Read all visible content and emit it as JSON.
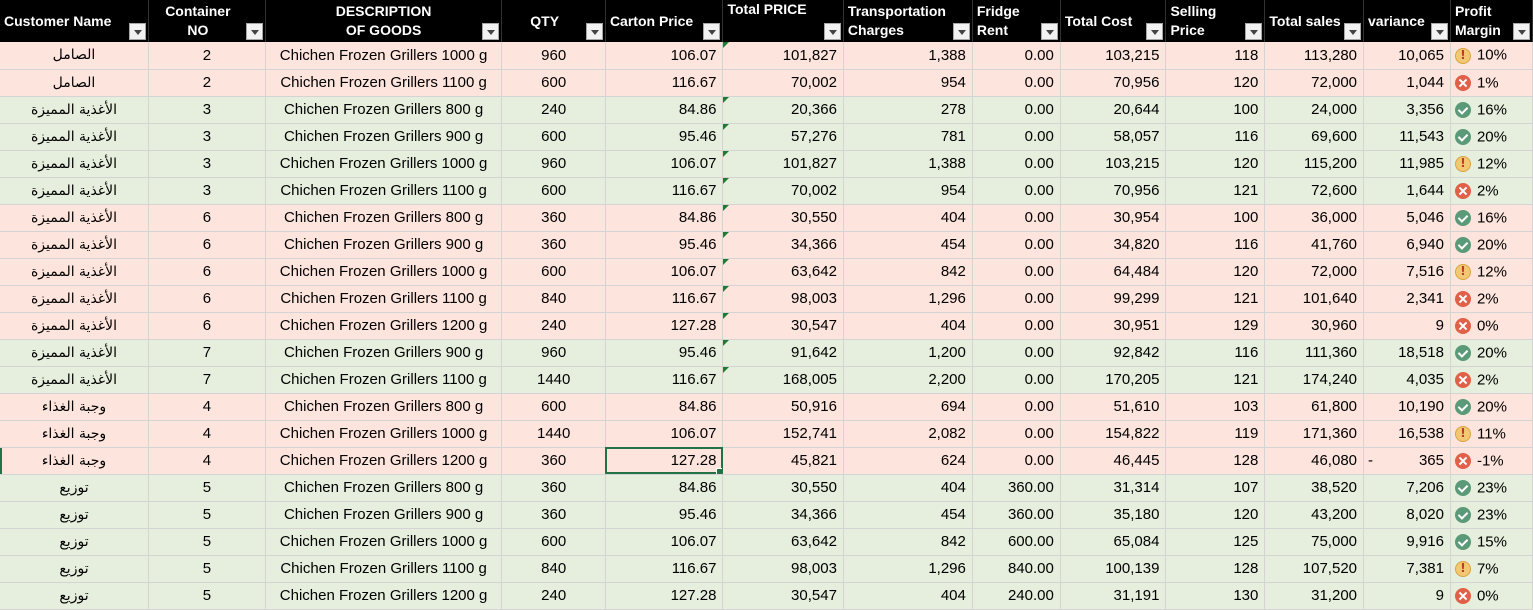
{
  "headers": [
    {
      "key": "customer",
      "label": "Customer Name"
    },
    {
      "key": "container",
      "label": "Container NO"
    },
    {
      "key": "description",
      "label": "DESCRIPTION OF GOODS"
    },
    {
      "key": "qty",
      "label": "QTY"
    },
    {
      "key": "carton_price",
      "label": "Carton Price"
    },
    {
      "key": "total_price",
      "label": "Total PRICE"
    },
    {
      "key": "transport",
      "label": "Transportation Charges"
    },
    {
      "key": "fridge",
      "label": "Fridge Rent"
    },
    {
      "key": "total_cost",
      "label": "Total Cost"
    },
    {
      "key": "selling",
      "label": "Selling Price"
    },
    {
      "key": "total_sales",
      "label": "Total sales"
    },
    {
      "key": "variance",
      "label": "variance"
    },
    {
      "key": "margin",
      "label": "Profit Margin"
    }
  ],
  "rows": [
    {
      "customer": "الصامل",
      "container": "2",
      "description": "Chichen Frozen Grillers 1000 g",
      "qty": "960",
      "carton_price": "106.07",
      "total_price": "101,827",
      "transport": "1,388",
      "fridge": "0.00",
      "total_cost": "103,215",
      "selling": "118",
      "total_sales": "113,280",
      "variance": "10,065",
      "variance_sign": "",
      "margin": "10%",
      "margin_icon": "warn",
      "fill": "pink"
    },
    {
      "customer": "الصامل",
      "container": "2",
      "description": "Chichen Frozen Grillers 1100 g",
      "qty": "600",
      "carton_price": "116.67",
      "total_price": "70,002",
      "transport": "954",
      "fridge": "0.00",
      "total_cost": "70,956",
      "selling": "120",
      "total_sales": "72,000",
      "variance": "1,044",
      "variance_sign": "",
      "margin": "1%",
      "margin_icon": "bad",
      "fill": "pink"
    },
    {
      "customer": "الأغذية المميزة",
      "container": "3",
      "description": "Chichen Frozen Grillers 800 g",
      "qty": "240",
      "carton_price": "84.86",
      "total_price": "20,366",
      "transport": "278",
      "fridge": "0.00",
      "total_cost": "20,644",
      "selling": "100",
      "total_sales": "24,000",
      "variance": "3,356",
      "variance_sign": "",
      "margin": "16%",
      "margin_icon": "ok",
      "fill": "green"
    },
    {
      "customer": "الأغذية المميزة",
      "container": "3",
      "description": "Chichen Frozen Grillers 900 g",
      "qty": "600",
      "carton_price": "95.46",
      "total_price": "57,276",
      "transport": "781",
      "fridge": "0.00",
      "total_cost": "58,057",
      "selling": "116",
      "total_sales": "69,600",
      "variance": "11,543",
      "variance_sign": "",
      "margin": "20%",
      "margin_icon": "ok",
      "fill": "green"
    },
    {
      "customer": "الأغذية المميزة",
      "container": "3",
      "description": "Chichen Frozen Grillers 1000 g",
      "qty": "960",
      "carton_price": "106.07",
      "total_price": "101,827",
      "transport": "1,388",
      "fridge": "0.00",
      "total_cost": "103,215",
      "selling": "120",
      "total_sales": "115,200",
      "variance": "11,985",
      "variance_sign": "",
      "margin": "12%",
      "margin_icon": "warn",
      "fill": "green"
    },
    {
      "customer": "الأغذية المميزة",
      "container": "3",
      "description": "Chichen Frozen Grillers 1100 g",
      "qty": "600",
      "carton_price": "116.67",
      "total_price": "70,002",
      "transport": "954",
      "fridge": "0.00",
      "total_cost": "70,956",
      "selling": "121",
      "total_sales": "72,600",
      "variance": "1,644",
      "variance_sign": "",
      "margin": "2%",
      "margin_icon": "bad",
      "fill": "green"
    },
    {
      "customer": "الأغذية المميزة",
      "container": "6",
      "description": "Chichen Frozen Grillers 800 g",
      "qty": "360",
      "carton_price": "84.86",
      "total_price": "30,550",
      "transport": "404",
      "fridge": "0.00",
      "total_cost": "30,954",
      "selling": "100",
      "total_sales": "36,000",
      "variance": "5,046",
      "variance_sign": "",
      "margin": "16%",
      "margin_icon": "ok",
      "fill": "pink"
    },
    {
      "customer": "الأغذية المميزة",
      "container": "6",
      "description": "Chichen Frozen Grillers 900 g",
      "qty": "360",
      "carton_price": "95.46",
      "total_price": "34,366",
      "transport": "454",
      "fridge": "0.00",
      "total_cost": "34,820",
      "selling": "116",
      "total_sales": "41,760",
      "variance": "6,940",
      "variance_sign": "",
      "margin": "20%",
      "margin_icon": "ok",
      "fill": "pink"
    },
    {
      "customer": "الأغذية المميزة",
      "container": "6",
      "description": "Chichen Frozen Grillers 1000 g",
      "qty": "600",
      "carton_price": "106.07",
      "total_price": "63,642",
      "transport": "842",
      "fridge": "0.00",
      "total_cost": "64,484",
      "selling": "120",
      "total_sales": "72,000",
      "variance": "7,516",
      "variance_sign": "",
      "margin": "12%",
      "margin_icon": "warn",
      "fill": "pink"
    },
    {
      "customer": "الأغذية المميزة",
      "container": "6",
      "description": "Chichen Frozen Grillers 1100 g",
      "qty": "840",
      "carton_price": "116.67",
      "total_price": "98,003",
      "transport": "1,296",
      "fridge": "0.00",
      "total_cost": "99,299",
      "selling": "121",
      "total_sales": "101,640",
      "variance": "2,341",
      "variance_sign": "",
      "margin": "2%",
      "margin_icon": "bad",
      "fill": "pink"
    },
    {
      "customer": "الأغذية المميزة",
      "container": "6",
      "description": "Chichen Frozen Grillers 1200 g",
      "qty": "240",
      "carton_price": "127.28",
      "total_price": "30,547",
      "transport": "404",
      "fridge": "0.00",
      "total_cost": "30,951",
      "selling": "129",
      "total_sales": "30,960",
      "variance": "9",
      "variance_sign": "",
      "margin": "0%",
      "margin_icon": "bad",
      "fill": "pink"
    },
    {
      "customer": "الأغذية المميزة",
      "container": "7",
      "description": "Chichen Frozen Grillers 900 g",
      "qty": "960",
      "carton_price": "95.46",
      "total_price": "91,642",
      "transport": "1,200",
      "fridge": "0.00",
      "total_cost": "92,842",
      "selling": "116",
      "total_sales": "111,360",
      "variance": "18,518",
      "variance_sign": "",
      "margin": "20%",
      "margin_icon": "ok",
      "fill": "green"
    },
    {
      "customer": "الأغذية المميزة",
      "container": "7",
      "description": "Chichen Frozen Grillers 1100 g",
      "qty": "1440",
      "carton_price": "116.67",
      "total_price": "168,005",
      "transport": "2,200",
      "fridge": "0.00",
      "total_cost": "170,205",
      "selling": "121",
      "total_sales": "174,240",
      "variance": "4,035",
      "variance_sign": "",
      "margin": "2%",
      "margin_icon": "bad",
      "fill": "green"
    },
    {
      "customer": "وجبة الغذاء",
      "container": "4",
      "description": "Chichen Frozen Grillers 800 g",
      "qty": "600",
      "carton_price": "84.86",
      "total_price": "50,916",
      "transport": "694",
      "fridge": "0.00",
      "total_cost": "51,610",
      "selling": "103",
      "total_sales": "61,800",
      "variance": "10,190",
      "variance_sign": "",
      "margin": "20%",
      "margin_icon": "ok",
      "fill": "pink"
    },
    {
      "customer": "وجبة الغذاء",
      "container": "4",
      "description": "Chichen Frozen Grillers 1000 g",
      "qty": "1440",
      "carton_price": "106.07",
      "total_price": "152,741",
      "transport": "2,082",
      "fridge": "0.00",
      "total_cost": "154,822",
      "selling": "119",
      "total_sales": "171,360",
      "variance": "16,538",
      "variance_sign": "",
      "margin": "11%",
      "margin_icon": "warn",
      "fill": "pink"
    },
    {
      "customer": "وجبة الغذاء",
      "container": "4",
      "description": "Chichen Frozen Grillers 1200 g",
      "qty": "360",
      "carton_price": "127.28",
      "total_price": "45,821",
      "transport": "624",
      "fridge": "0.00",
      "total_cost": "46,445",
      "selling": "128",
      "total_sales": "46,080",
      "variance": "365",
      "variance_sign": "-",
      "margin": "-1%",
      "margin_icon": "bad",
      "fill": "pink",
      "selected": true
    },
    {
      "customer": "توزيع",
      "container": "5",
      "description": "Chichen Frozen Grillers 800 g",
      "qty": "360",
      "carton_price": "84.86",
      "total_price": "30,550",
      "transport": "404",
      "fridge": "360.00",
      "total_cost": "31,314",
      "selling": "107",
      "total_sales": "38,520",
      "variance": "7,206",
      "variance_sign": "",
      "margin": "23%",
      "margin_icon": "ok",
      "fill": "green"
    },
    {
      "customer": "توزيع",
      "container": "5",
      "description": "Chichen Frozen Grillers 900 g",
      "qty": "360",
      "carton_price": "95.46",
      "total_price": "34,366",
      "transport": "454",
      "fridge": "360.00",
      "total_cost": "35,180",
      "selling": "120",
      "total_sales": "43,200",
      "variance": "8,020",
      "variance_sign": "",
      "margin": "23%",
      "margin_icon": "ok",
      "fill": "green"
    },
    {
      "customer": "توزيع",
      "container": "5",
      "description": "Chichen Frozen Grillers 1000 g",
      "qty": "600",
      "carton_price": "106.07",
      "total_price": "63,642",
      "transport": "842",
      "fridge": "600.00",
      "total_cost": "65,084",
      "selling": "125",
      "total_sales": "75,000",
      "variance": "9,916",
      "variance_sign": "",
      "margin": "15%",
      "margin_icon": "ok",
      "fill": "green"
    },
    {
      "customer": "توزيع",
      "container": "5",
      "description": "Chichen Frozen Grillers 1100 g",
      "qty": "840",
      "carton_price": "116.67",
      "total_price": "98,003",
      "transport": "1,296",
      "fridge": "840.00",
      "total_cost": "100,139",
      "selling": "128",
      "total_sales": "107,520",
      "variance": "7,381",
      "variance_sign": "",
      "margin": "7%",
      "margin_icon": "warn",
      "fill": "green"
    },
    {
      "customer": "توزيع",
      "container": "5",
      "description": "Chichen Frozen Grillers 1200 g",
      "qty": "240",
      "carton_price": "127.28",
      "total_price": "30,547",
      "transport": "404",
      "fridge": "240.00",
      "total_cost": "31,191",
      "selling": "130",
      "total_sales": "31,200",
      "variance": "9",
      "variance_sign": "",
      "margin": "0%",
      "margin_icon": "bad",
      "fill": "green"
    }
  ]
}
